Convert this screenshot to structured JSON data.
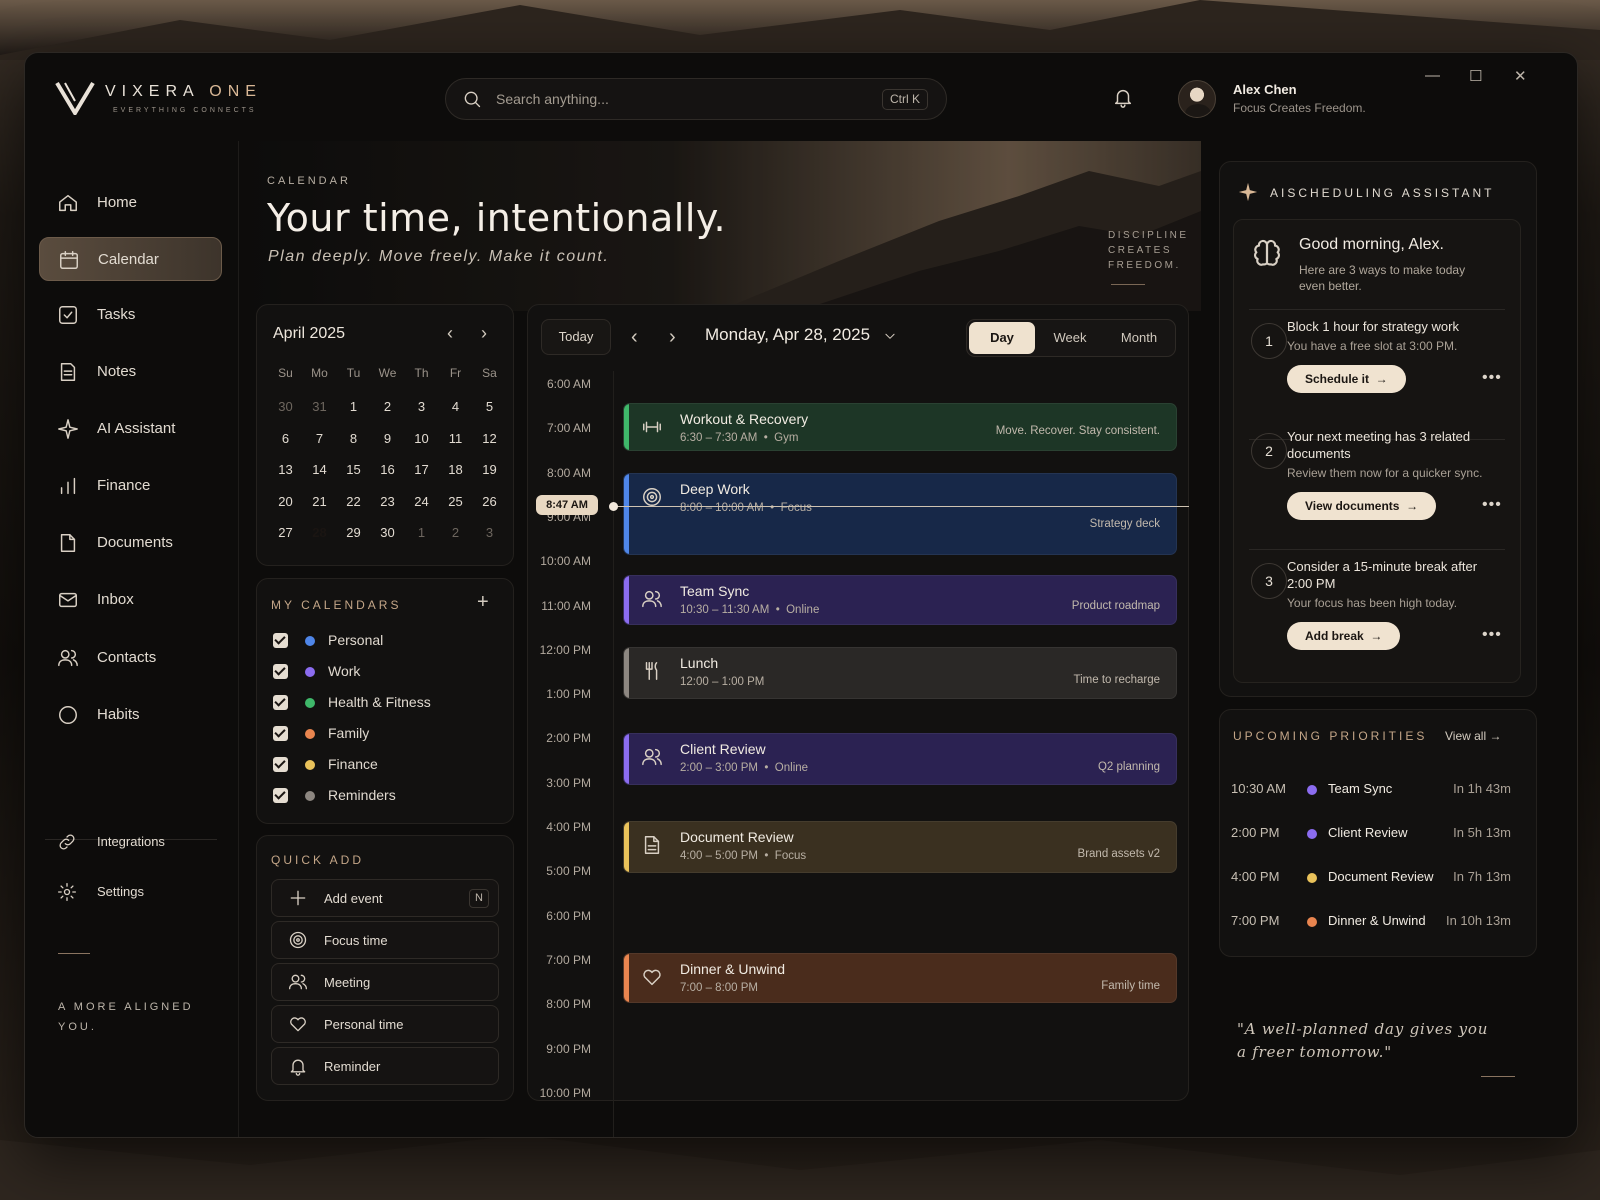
{
  "brand": {
    "name_main": "VIXERA",
    "name_accent": "ONE",
    "tagline": "EVERYTHING CONNECTS"
  },
  "search": {
    "placeholder": "Search anything...",
    "shortcut": "Ctrl K"
  },
  "user": {
    "name": "Alex Chen",
    "motto": "Focus Creates Freedom."
  },
  "window_controls": {
    "minimize": "—",
    "maximize": "☐",
    "close": "✕"
  },
  "sidebar": {
    "items": [
      {
        "label": "Home",
        "icon": "home-icon"
      },
      {
        "label": "Calendar",
        "icon": "calendar-icon",
        "active": true
      },
      {
        "label": "Tasks",
        "icon": "tasks-icon"
      },
      {
        "label": "Notes",
        "icon": "notes-icon"
      },
      {
        "label": "AI Assistant",
        "icon": "sparkle-icon"
      },
      {
        "label": "Finance",
        "icon": "finance-icon"
      },
      {
        "label": "Documents",
        "icon": "documents-icon"
      },
      {
        "label": "Inbox",
        "icon": "inbox-icon"
      },
      {
        "label": "Contacts",
        "icon": "contacts-icon"
      },
      {
        "label": "Habits",
        "icon": "habits-icon"
      }
    ],
    "bottom": [
      {
        "label": "Integrations",
        "icon": "link-icon"
      },
      {
        "label": "Settings",
        "icon": "gear-icon"
      }
    ],
    "motto": "A MORE ALIGNED YOU."
  },
  "hero": {
    "eyebrow": "CALENDAR",
    "title": "Your time, intentionally.",
    "subtitle": "Plan deeply. Move freely. Make it count.",
    "side_note": "DISCIPLINE CREATES FREEDOM."
  },
  "mini_calendar": {
    "month": "April 2025",
    "prev": "‹",
    "next": "›",
    "weekdays": [
      "Su",
      "Mo",
      "Tu",
      "We",
      "Th",
      "Fr",
      "Sa"
    ],
    "weeks": [
      [
        "30",
        "31",
        "1",
        "2",
        "3",
        "4",
        "5"
      ],
      [
        "6",
        "7",
        "8",
        "9",
        "10",
        "11",
        "12"
      ],
      [
        "13",
        "14",
        "15",
        "16",
        "17",
        "18",
        "19"
      ],
      [
        "20",
        "21",
        "22",
        "23",
        "24",
        "25",
        "26"
      ],
      [
        "27",
        "28",
        "29",
        "30",
        "1",
        "2",
        "3"
      ]
    ],
    "selected": "28"
  },
  "my_calendars": {
    "title": "MY CALENDARS",
    "add": "+",
    "items": [
      {
        "label": "Personal",
        "color": "#4f86e8",
        "checked": true
      },
      {
        "label": "Work",
        "color": "#8b6cf0",
        "checked": true
      },
      {
        "label": "Health & Fitness",
        "color": "#3fb86a",
        "checked": true
      },
      {
        "label": "Family",
        "color": "#e9854f",
        "checked": true
      },
      {
        "label": "Finance",
        "color": "#e9c25a",
        "checked": true
      },
      {
        "label": "Reminders",
        "color": "#8d8781",
        "checked": true
      }
    ]
  },
  "quick_add": {
    "title": "QUICK ADD",
    "items": [
      {
        "label": "Add event",
        "icon": "plus-icon",
        "shortcut": "N"
      },
      {
        "label": "Focus time",
        "icon": "target-icon"
      },
      {
        "label": "Meeting",
        "icon": "people-icon"
      },
      {
        "label": "Personal time",
        "icon": "heart-icon"
      },
      {
        "label": "Reminder",
        "icon": "bell-icon"
      }
    ]
  },
  "day_view": {
    "today": "Today",
    "prev": "‹",
    "next": "›",
    "date": "Monday, Apr 28, 2025",
    "views": [
      "Day",
      "Week",
      "Month"
    ],
    "active_view": "Day",
    "now": "8:47 AM",
    "hours": [
      "6:00 AM",
      "7:00 AM",
      "8:00 AM",
      "9:00 AM",
      "10:00 AM",
      "11:00 AM",
      "12:00 PM",
      "1:00 PM",
      "2:00 PM",
      "3:00 PM",
      "4:00 PM",
      "5:00 PM",
      "6:00 PM",
      "7:00 PM",
      "8:00 PM",
      "9:00 PM",
      "10:00 PM"
    ],
    "events": [
      {
        "title": "Workout & Recovery",
        "meta": "6:30 – 7:30 AM  •  Gym",
        "note": "Move. Recover. Stay consistent.",
        "icon": "dumbbell-icon",
        "color": "#3fb86a",
        "bg": "#1d3626"
      },
      {
        "title": "Deep Work",
        "meta": "8:00 – 10:00 AM  •  Focus",
        "note": "Strategy deck",
        "icon": "target-icon",
        "color": "#4f86e8",
        "bg": "#172848"
      },
      {
        "title": "Team Sync",
        "meta": "10:30 – 11:30 AM  •  Online",
        "note": "Product roadmap",
        "icon": "people-icon",
        "color": "#8b6cf0",
        "bg": "#2b2252"
      },
      {
        "title": "Lunch",
        "meta": "12:00 – 1:00 PM",
        "note": "Time to recharge",
        "icon": "utensils-icon",
        "color": "#8d8781",
        "bg": "#2a2826"
      },
      {
        "title": "Client Review",
        "meta": "2:00 – 3:00 PM  •  Online",
        "note": "Q2 planning",
        "icon": "people-icon",
        "color": "#8b6cf0",
        "bg": "#2b2252"
      },
      {
        "title": "Document Review",
        "meta": "4:00 – 5:00 PM  •  Focus",
        "note": "Brand assets v2",
        "icon": "document-icon",
        "color": "#e9c25a",
        "bg": "#3a3020"
      },
      {
        "title": "Dinner & Unwind",
        "meta": "7:00 – 8:00 PM",
        "note": "Family time",
        "icon": "heart-icon",
        "color": "#e9854f",
        "bg": "#4a2c1c"
      }
    ]
  },
  "ai_assistant": {
    "title": "AISCHEDULING ASSISTANT",
    "greeting": "Good morning, Alex.",
    "greeting_sub": "Here are 3 ways to make today even better.",
    "suggestions": [
      {
        "num": "1",
        "title": "Block 1 hour for strategy work",
        "sub": "You have a free slot at 3:00 PM.",
        "action": "Schedule it  →"
      },
      {
        "num": "2",
        "title": "Your next meeting has 3 related documents",
        "sub": "Review them now for a quicker sync.",
        "action": "View documents  →"
      },
      {
        "num": "3",
        "title": "Consider a 15-minute break after 2:00 PM",
        "sub": "Your focus has been high today.",
        "action": "Add break  →"
      }
    ],
    "more": "•••"
  },
  "upcoming": {
    "title": "UPCOMING PRIORITIES",
    "view_all": "View all  →",
    "items": [
      {
        "time": "10:30 AM",
        "name": "Team Sync",
        "in": "In 1h 43m",
        "color": "#8b6cf0"
      },
      {
        "time": "2:00 PM",
        "name": "Client Review",
        "in": "In 5h 13m",
        "color": "#8b6cf0"
      },
      {
        "time": "4:00 PM",
        "name": "Document Review",
        "in": "In 7h 13m",
        "color": "#e9c25a"
      },
      {
        "time": "7:00 PM",
        "name": "Dinner & Unwind",
        "in": "In 10h 13m",
        "color": "#e9854f"
      }
    ]
  },
  "quote": "\"A well-planned day gives you a freer tomorrow.\""
}
